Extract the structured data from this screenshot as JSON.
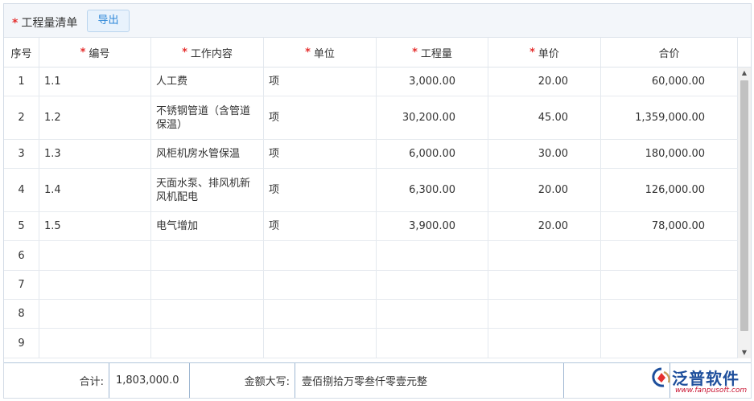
{
  "toolbar": {
    "required_mark": "*",
    "title": "工程量清单",
    "export_label": "导出"
  },
  "columns": [
    {
      "label": "序号",
      "required": false
    },
    {
      "label": "编号",
      "required": true
    },
    {
      "label": "工作内容",
      "required": true
    },
    {
      "label": "单位",
      "required": true
    },
    {
      "label": "工程量",
      "required": true
    },
    {
      "label": "单价",
      "required": true
    },
    {
      "label": "合价",
      "required": false
    }
  ],
  "rows": [
    {
      "seq": "1",
      "code": "1.1",
      "content": "人工费",
      "unit": "项",
      "qty": "3,000.00",
      "price": "20.00",
      "total": "60,000.00"
    },
    {
      "seq": "2",
      "code": "1.2",
      "content": "不锈钢管道（含管道保温）",
      "unit": "项",
      "qty": "30,200.00",
      "price": "45.00",
      "total": "1,359,000.00"
    },
    {
      "seq": "3",
      "code": "1.3",
      "content": "风柜机房水管保温",
      "unit": "项",
      "qty": "6,000.00",
      "price": "30.00",
      "total": "180,000.00"
    },
    {
      "seq": "4",
      "code": "1.4",
      "content": "天面水泵、排风机新风机配电",
      "unit": "项",
      "qty": "6,300.00",
      "price": "20.00",
      "total": "126,000.00"
    },
    {
      "seq": "5",
      "code": "1.5",
      "content": "电气增加",
      "unit": "项",
      "qty": "3,900.00",
      "price": "20.00",
      "total": "78,000.00"
    },
    {
      "seq": "6",
      "code": "",
      "content": "",
      "unit": "",
      "qty": "",
      "price": "",
      "total": ""
    },
    {
      "seq": "7",
      "code": "",
      "content": "",
      "unit": "",
      "qty": "",
      "price": "",
      "total": ""
    },
    {
      "seq": "8",
      "code": "",
      "content": "",
      "unit": "",
      "qty": "",
      "price": "",
      "total": ""
    },
    {
      "seq": "9",
      "code": "",
      "content": "",
      "unit": "",
      "qty": "",
      "price": "",
      "total": ""
    }
  ],
  "footer": {
    "sum_label": "合计:",
    "sum_value": "1,803,000.0",
    "amount_label": "金额大写:",
    "amount_value": "壹佰捌拾万零叁仟零壹元整"
  },
  "logo": {
    "name": "泛普软件",
    "url": "www.fanpusoft.com"
  }
}
